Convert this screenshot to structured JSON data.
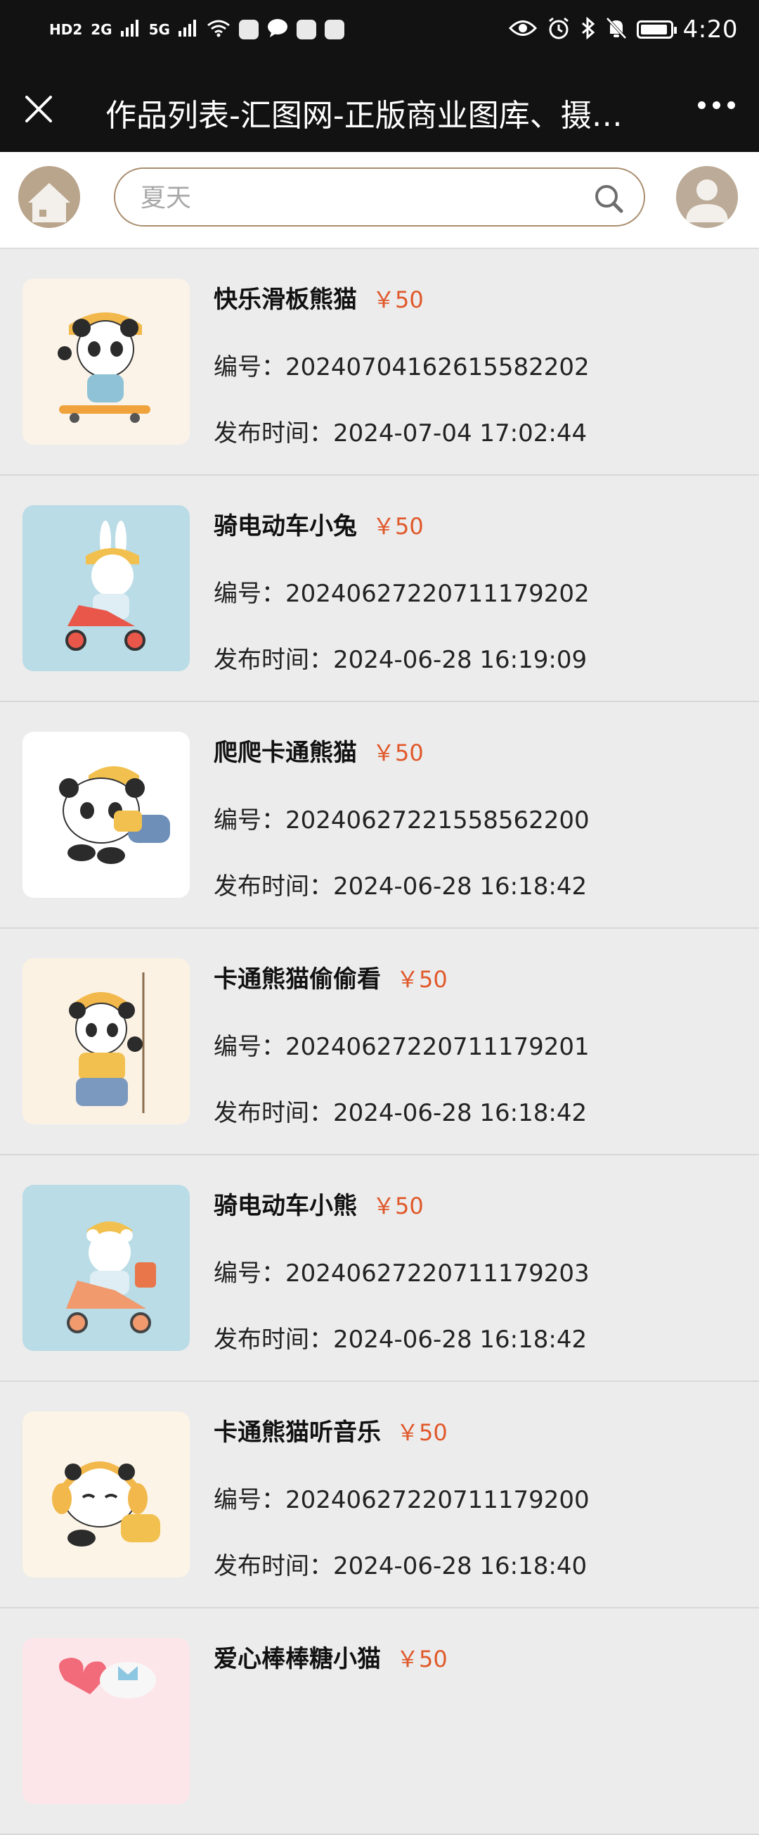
{
  "status_bar": {
    "left_indicators": [
      "HD2",
      "2G",
      "5G"
    ],
    "time": "4:20"
  },
  "titlebar": {
    "title": "作品列表-汇图网-正版商业图库、摄…"
  },
  "search": {
    "placeholder": "夏天"
  },
  "items": [
    {
      "title": "快乐滑板熊猫",
      "price": "￥50",
      "code": "编号：20240704162615582202",
      "date": "发布时间：2024-07-04 17:02:44",
      "bg": "#fbf3e8"
    },
    {
      "title": "骑电动车小兔",
      "price": "￥50",
      "code": "编号：20240627220711179202",
      "date": "发布时间：2024-06-28 16:19:09",
      "bg": "#b9dce6"
    },
    {
      "title": "爬爬卡通熊猫",
      "price": "￥50",
      "code": "编号：20240627221558562200",
      "date": "发布时间：2024-06-28 16:18:42",
      "bg": "#ffffff"
    },
    {
      "title": "卡通熊猫偷偷看",
      "price": "￥50",
      "code": "编号：20240627220711179201",
      "date": "发布时间：2024-06-28 16:18:42",
      "bg": "#fcf2e4"
    },
    {
      "title": "骑电动车小熊",
      "price": "￥50",
      "code": "编号：20240627220711179203",
      "date": "发布时间：2024-06-28 16:18:42",
      "bg": "#b9dce6"
    },
    {
      "title": "卡通熊猫听音乐",
      "price": "￥50",
      "code": "编号：20240627220711179200",
      "date": "发布时间：2024-06-28 16:18:40",
      "bg": "#fcf4e6"
    },
    {
      "title": "爱心棒棒糖小猫",
      "price": "￥50",
      "bg": "#fde6ea"
    }
  ]
}
